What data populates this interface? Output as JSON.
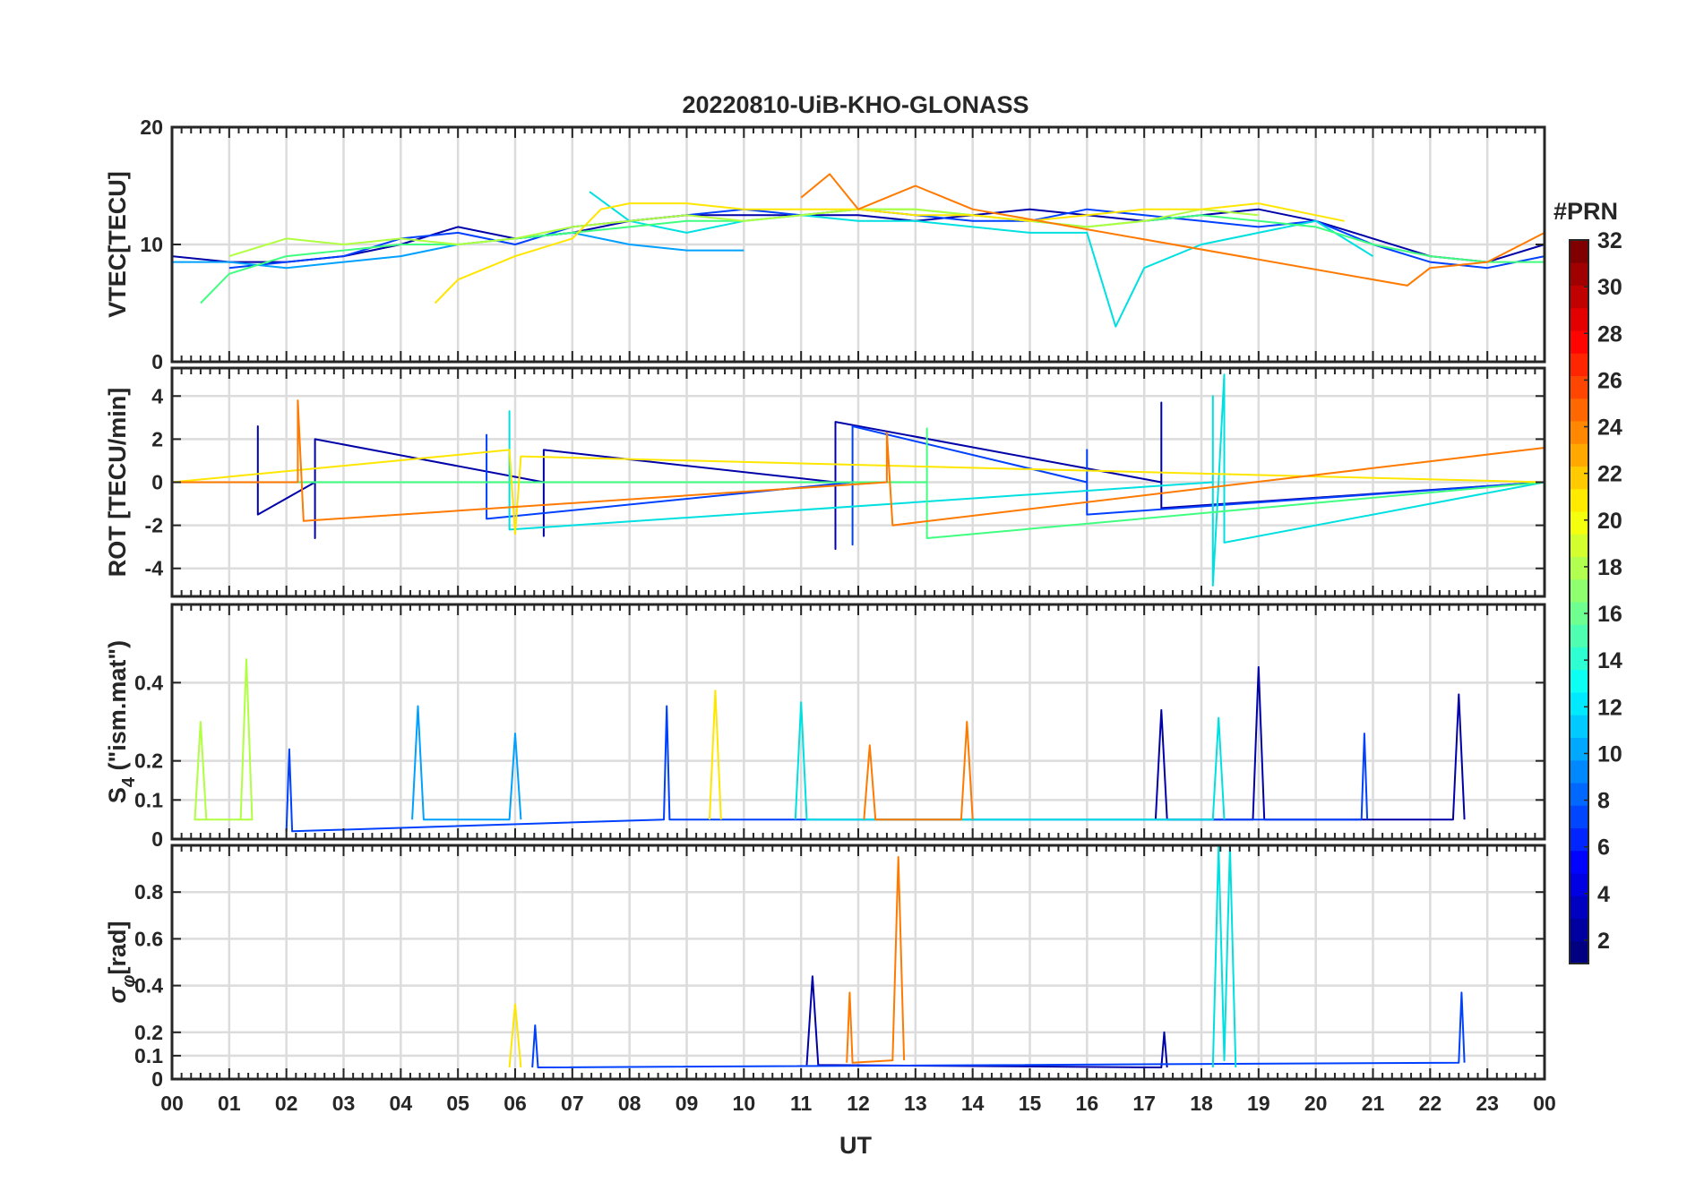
{
  "figure": {
    "title": "20220810-UiB-KHO-GLONASS",
    "xlabel": "UT"
  },
  "colorbar": {
    "title": "#PRN",
    "ticks": [
      "2",
      "4",
      "6",
      "8",
      "10",
      "12",
      "14",
      "16",
      "18",
      "20",
      "22",
      "24",
      "26",
      "28",
      "30",
      "32"
    ],
    "range": [
      1,
      32
    ],
    "colormap": "jet"
  },
  "chart_data": [
    {
      "type": "line",
      "panel": "vtec",
      "ylabel": "VTEC[TECU]",
      "ylim": [
        0,
        20
      ],
      "yticks": [
        "0",
        "10",
        "20"
      ],
      "xlim": [
        0,
        24
      ],
      "xticks": [
        "00",
        "01",
        "02",
        "03",
        "04",
        "05",
        "06",
        "07",
        "08",
        "09",
        "10",
        "11",
        "12",
        "13",
        "14",
        "15",
        "16",
        "17",
        "18",
        "19",
        "20",
        "21",
        "22",
        "23",
        "00"
      ],
      "grid": true,
      "series": [
        {
          "color": "#0000a8",
          "x": [
            0,
            1,
            2,
            3,
            4,
            5,
            6,
            7,
            8,
            9,
            10,
            11,
            12,
            13,
            14,
            15,
            16,
            17,
            18,
            19,
            20,
            21,
            22,
            23,
            24
          ],
          "y": [
            9,
            8.5,
            8.5,
            9,
            10,
            11.5,
            10.5,
            11,
            12,
            12.5,
            12.5,
            12.5,
            12.5,
            12,
            12.5,
            13,
            12.5,
            12,
            12.5,
            13,
            12,
            10.5,
            9,
            8.5,
            10
          ]
        },
        {
          "color": "#0040ff",
          "x": [
            1,
            2,
            3,
            4,
            5,
            6,
            7,
            8,
            9,
            10,
            11,
            12,
            13,
            14,
            15,
            16,
            17,
            18,
            19,
            20,
            21,
            22,
            23,
            24
          ],
          "y": [
            8,
            8.5,
            9,
            10.5,
            11,
            10,
            11.5,
            12,
            12.5,
            13,
            12.5,
            13,
            12.5,
            12,
            12,
            13,
            12.5,
            12,
            11.5,
            12,
            10,
            8.5,
            8,
            9
          ]
        },
        {
          "color": "#00a0ff",
          "x": [
            0,
            1,
            2,
            3,
            4,
            5,
            6,
            7,
            8,
            9,
            10
          ],
          "y": [
            8.5,
            8.5,
            8,
            8.5,
            9,
            10,
            10.5,
            11,
            10,
            9.5,
            9.5
          ]
        },
        {
          "color": "#00e0e0",
          "x": [
            7.3,
            8,
            9,
            10,
            11,
            12,
            13,
            14,
            15,
            16,
            16.5,
            17,
            18,
            19,
            20,
            21
          ],
          "y": [
            14.5,
            12,
            11,
            12,
            12.5,
            12,
            12,
            11.5,
            11,
            11,
            3,
            8,
            10,
            11,
            12,
            9
          ]
        },
        {
          "color": "#40ff80",
          "x": [
            0.5,
            1,
            2,
            3,
            4,
            5,
            6,
            7,
            8,
            9,
            10,
            11,
            12,
            13,
            14,
            15,
            16,
            17,
            18,
            19,
            20,
            21,
            22,
            23,
            24
          ],
          "y": [
            5,
            7.5,
            9,
            9.5,
            10,
            10,
            10.5,
            11,
            11.5,
            12,
            12,
            12.5,
            13,
            13,
            12.5,
            12,
            11.5,
            12,
            12.5,
            12,
            11.5,
            10,
            9,
            8.5,
            8.5
          ]
        },
        {
          "color": "#b0ff40",
          "x": [
            1,
            2,
            3,
            4,
            5,
            6,
            7,
            8,
            9,
            10,
            11,
            12,
            13,
            14,
            15,
            16,
            17,
            18,
            19
          ],
          "y": [
            9,
            10.5,
            10,
            10.5,
            10,
            10.5,
            11.5,
            12,
            12.5,
            12,
            12.5,
            13,
            13,
            12.5,
            12,
            11.5,
            12,
            13,
            12.5
          ]
        },
        {
          "color": "#ffe600",
          "x": [
            4.6,
            5,
            6,
            7,
            7.5,
            8,
            9,
            10,
            11,
            12,
            13,
            14,
            15,
            16,
            17,
            18,
            19,
            20,
            20.5
          ],
          "y": [
            5,
            7,
            9,
            10.5,
            13,
            13.5,
            13.5,
            13,
            13,
            13,
            12.5,
            12.5,
            12,
            12.5,
            13,
            13,
            13.5,
            12.5,
            12
          ]
        },
        {
          "color": "#ff7a00",
          "x": [
            11,
            11.5,
            12,
            12.5,
            13,
            13.5,
            14,
            21.6,
            22,
            23,
            24
          ],
          "y": [
            14,
            16,
            13,
            14,
            15,
            14,
            13,
            6.5,
            8,
            8.5,
            11
          ]
        }
      ]
    },
    {
      "type": "line",
      "panel": "rot",
      "ylabel": "ROT [TECU/min]",
      "ylim": [
        -5.3,
        5.3
      ],
      "yticks": [
        "-4",
        "-2",
        "0",
        "2",
        "4"
      ],
      "xlim": [
        0,
        24
      ],
      "grid": true,
      "series": [
        {
          "color": "#0000a8",
          "x": [
            0,
            1.5,
            1.5,
            1.5,
            2.5,
            2.5,
            2.5,
            6.5,
            6.5,
            6.5,
            11.6,
            11.6,
            11.6,
            17.3,
            17.3,
            17.3,
            24
          ],
          "y": [
            0,
            0,
            2.6,
            -1.5,
            0,
            -2.6,
            2,
            0,
            -2.5,
            1.5,
            0,
            -3.1,
            2.8,
            0,
            3.7,
            -1.2,
            0
          ]
        },
        {
          "color": "#0040ff",
          "x": [
            0,
            5.5,
            5.5,
            5.5,
            11.9,
            11.9,
            11.9,
            16,
            16,
            16,
            24
          ],
          "y": [
            0,
            0,
            2.2,
            -1.7,
            0,
            -2.9,
            2.6,
            0,
            1.5,
            -1.5,
            0
          ]
        },
        {
          "color": "#00e0e0",
          "x": [
            0,
            5.9,
            5.9,
            5.9,
            18.2,
            18.2,
            18.2,
            18.3,
            18.4,
            18.4,
            24
          ],
          "y": [
            0,
            0,
            3.3,
            -2.2,
            0,
            4,
            -4.8,
            0,
            5,
            -2.8,
            0
          ]
        },
        {
          "color": "#40ff80",
          "x": [
            0,
            13.2,
            13.2,
            13.2,
            24
          ],
          "y": [
            0,
            0,
            2.5,
            -2.6,
            0
          ]
        },
        {
          "color": "#ffe600",
          "x": [
            0,
            5.9,
            6,
            6.1,
            24
          ],
          "y": [
            0,
            1.5,
            -2.4,
            1.2,
            0
          ]
        },
        {
          "color": "#ff7a00",
          "x": [
            0,
            2.2,
            2.2,
            2.3,
            12.5,
            12.5,
            12.6,
            24,
            24
          ],
          "y": [
            0,
            0,
            3.8,
            -1.8,
            0,
            2.3,
            -2,
            1.6,
            -1.2
          ]
        }
      ]
    },
    {
      "type": "line",
      "panel": "s4",
      "ylabel": "S4 (\"ism.mat\")",
      "ylabel_main": "S",
      "ylabel_sub": "4",
      "ylabel_rest": " (\"ism.mat\")",
      "ylim": [
        0,
        0.6
      ],
      "yticks": [
        "0",
        "0.1",
        "0.2",
        "0.4"
      ],
      "xlim": [
        0,
        24
      ],
      "grid": true,
      "series": [
        {
          "color": "#0000a8",
          "x": [
            17.2,
            17.3,
            17.4,
            18.9,
            19,
            19.1,
            22.4,
            22.5,
            22.6
          ],
          "y": [
            0.05,
            0.33,
            0.05,
            0.05,
            0.44,
            0.05,
            0.05,
            0.37,
            0.05
          ]
        },
        {
          "color": "#0040ff",
          "x": [
            2,
            2.05,
            2.1,
            8.6,
            8.65,
            8.7,
            20.8,
            20.85,
            20.9
          ],
          "y": [
            0.02,
            0.23,
            0.02,
            0.05,
            0.34,
            0.05,
            0.05,
            0.27,
            0.05
          ]
        },
        {
          "color": "#00a0ff",
          "x": [
            4.2,
            4.3,
            4.4,
            5.9,
            6,
            6.1
          ],
          "y": [
            0.05,
            0.34,
            0.05,
            0.05,
            0.27,
            0.05
          ]
        },
        {
          "color": "#00e0e0",
          "x": [
            10.9,
            11,
            11.1,
            18.2,
            18.3,
            18.4
          ],
          "y": [
            0.05,
            0.35,
            0.05,
            0.05,
            0.31,
            0.05
          ]
        },
        {
          "color": "#b0ff40",
          "x": [
            1.2,
            1.3,
            1.4,
            0.4,
            0.5,
            0.6
          ],
          "y": [
            0.05,
            0.46,
            0.05,
            0.05,
            0.3,
            0.05
          ]
        },
        {
          "color": "#ffe600",
          "x": [
            9.4,
            9.5,
            9.6
          ],
          "y": [
            0.05,
            0.38,
            0.05
          ]
        },
        {
          "color": "#ff7a00",
          "x": [
            12.1,
            12.2,
            12.3,
            13.8,
            13.9,
            14
          ],
          "y": [
            0.05,
            0.24,
            0.05,
            0.05,
            0.3,
            0.05
          ]
        }
      ]
    },
    {
      "type": "line",
      "panel": "sigma_phi",
      "ylabel": "σφ[rad]",
      "ylabel_main": "σ",
      "ylabel_sub": "φ",
      "ylabel_rest": "[rad]",
      "ylim": [
        0,
        1
      ],
      "yticks": [
        "0",
        "0.1",
        "0.2",
        "0.4",
        "0.6",
        "0.8"
      ],
      "xlim": [
        0,
        24
      ],
      "grid": true,
      "series": [
        {
          "color": "#0000a8",
          "x": [
            11.1,
            11.2,
            11.3,
            17.3,
            17.35,
            17.4
          ],
          "y": [
            0.06,
            0.44,
            0.06,
            0.05,
            0.2,
            0.05
          ]
        },
        {
          "color": "#0040ff",
          "x": [
            6.3,
            6.35,
            6.4,
            22.5,
            22.55,
            22.6
          ],
          "y": [
            0.05,
            0.23,
            0.05,
            0.07,
            0.37,
            0.07
          ]
        },
        {
          "color": "#00e0e0",
          "x": [
            18.2,
            18.3,
            18.4,
            18.5,
            18.6
          ],
          "y": [
            0.05,
            1,
            0.08,
            1,
            0.05
          ]
        },
        {
          "color": "#ffe600",
          "x": [
            5.9,
            6,
            6.1
          ],
          "y": [
            0.05,
            0.32,
            0.05
          ]
        },
        {
          "color": "#ff7a00",
          "x": [
            11.8,
            11.85,
            11.9,
            12.6,
            12.7,
            12.8
          ],
          "y": [
            0.07,
            0.37,
            0.07,
            0.08,
            0.95,
            0.08
          ]
        }
      ]
    }
  ]
}
